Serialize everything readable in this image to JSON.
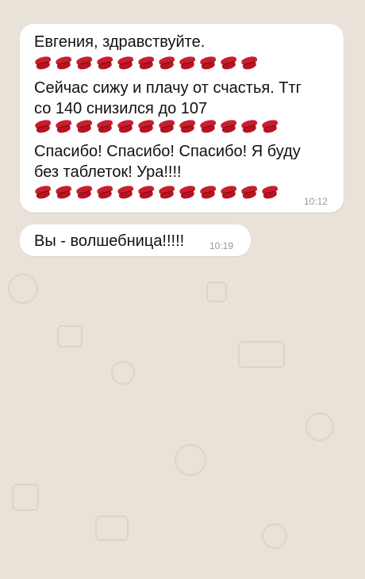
{
  "messages": [
    {
      "lines": [
        "Евгения, здравствуйте.",
        "Сейчас сижу и плачу от счастья. Ттг",
        "со 140 снизился до 107",
        "Спасибо! Спасибо! Спасибо! Я буду",
        "без таблеток! Ура!!!!"
      ],
      "time": "10:12",
      "emoji_name": "kiss-mark-icon"
    },
    {
      "text": "Вы - волшебница!!!!!",
      "time": "10:19"
    }
  ]
}
